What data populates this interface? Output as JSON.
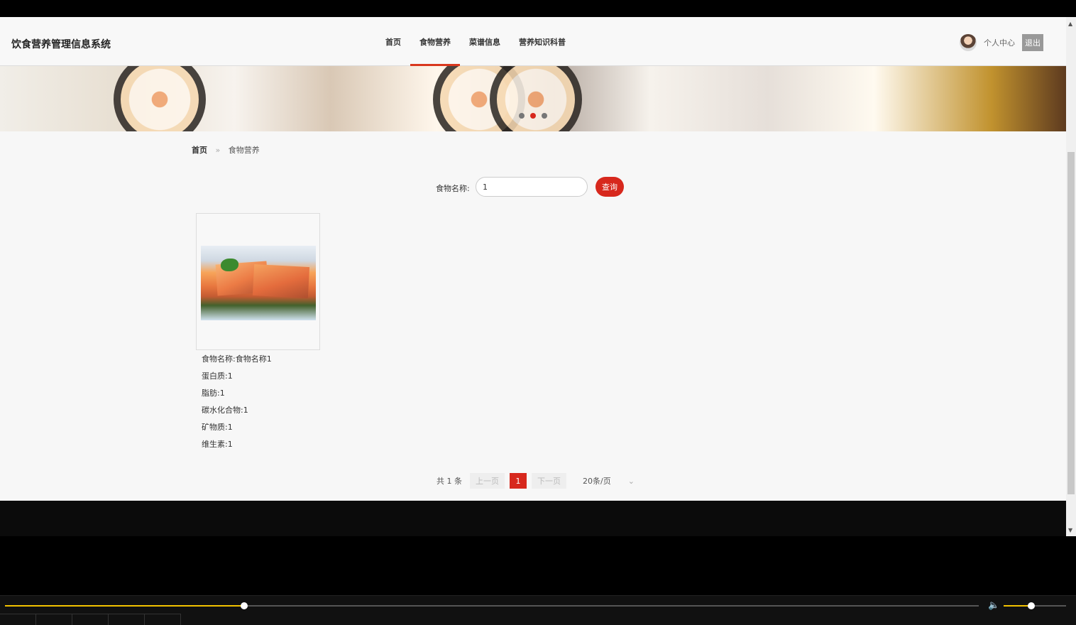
{
  "header": {
    "title": "饮食营养管理信息系统",
    "nav": [
      "首页",
      "食物营养",
      "菜谱信息",
      "营养知识科普"
    ],
    "active_nav": "食物营养",
    "user_center": "个人中心",
    "logout": "退出"
  },
  "breadcrumb": {
    "home": "首页",
    "separator": "»",
    "current": "食物营养"
  },
  "search": {
    "label": "食物名称:",
    "value": "1",
    "button": "查询"
  },
  "food": {
    "name": "食物名称:食物名称1",
    "protein": "蛋白质:1",
    "fat": "脂肪:1",
    "carbohydrate": "碳水化合物:1",
    "mineral": "矿物质:1",
    "vitamin": "维生素:1"
  },
  "pagination": {
    "total": "共 1 条",
    "prev": "上一页",
    "page": "1",
    "next": "下一页",
    "size": "20条/页"
  },
  "player": {
    "progress": 0.245,
    "volume": 0.44
  }
}
